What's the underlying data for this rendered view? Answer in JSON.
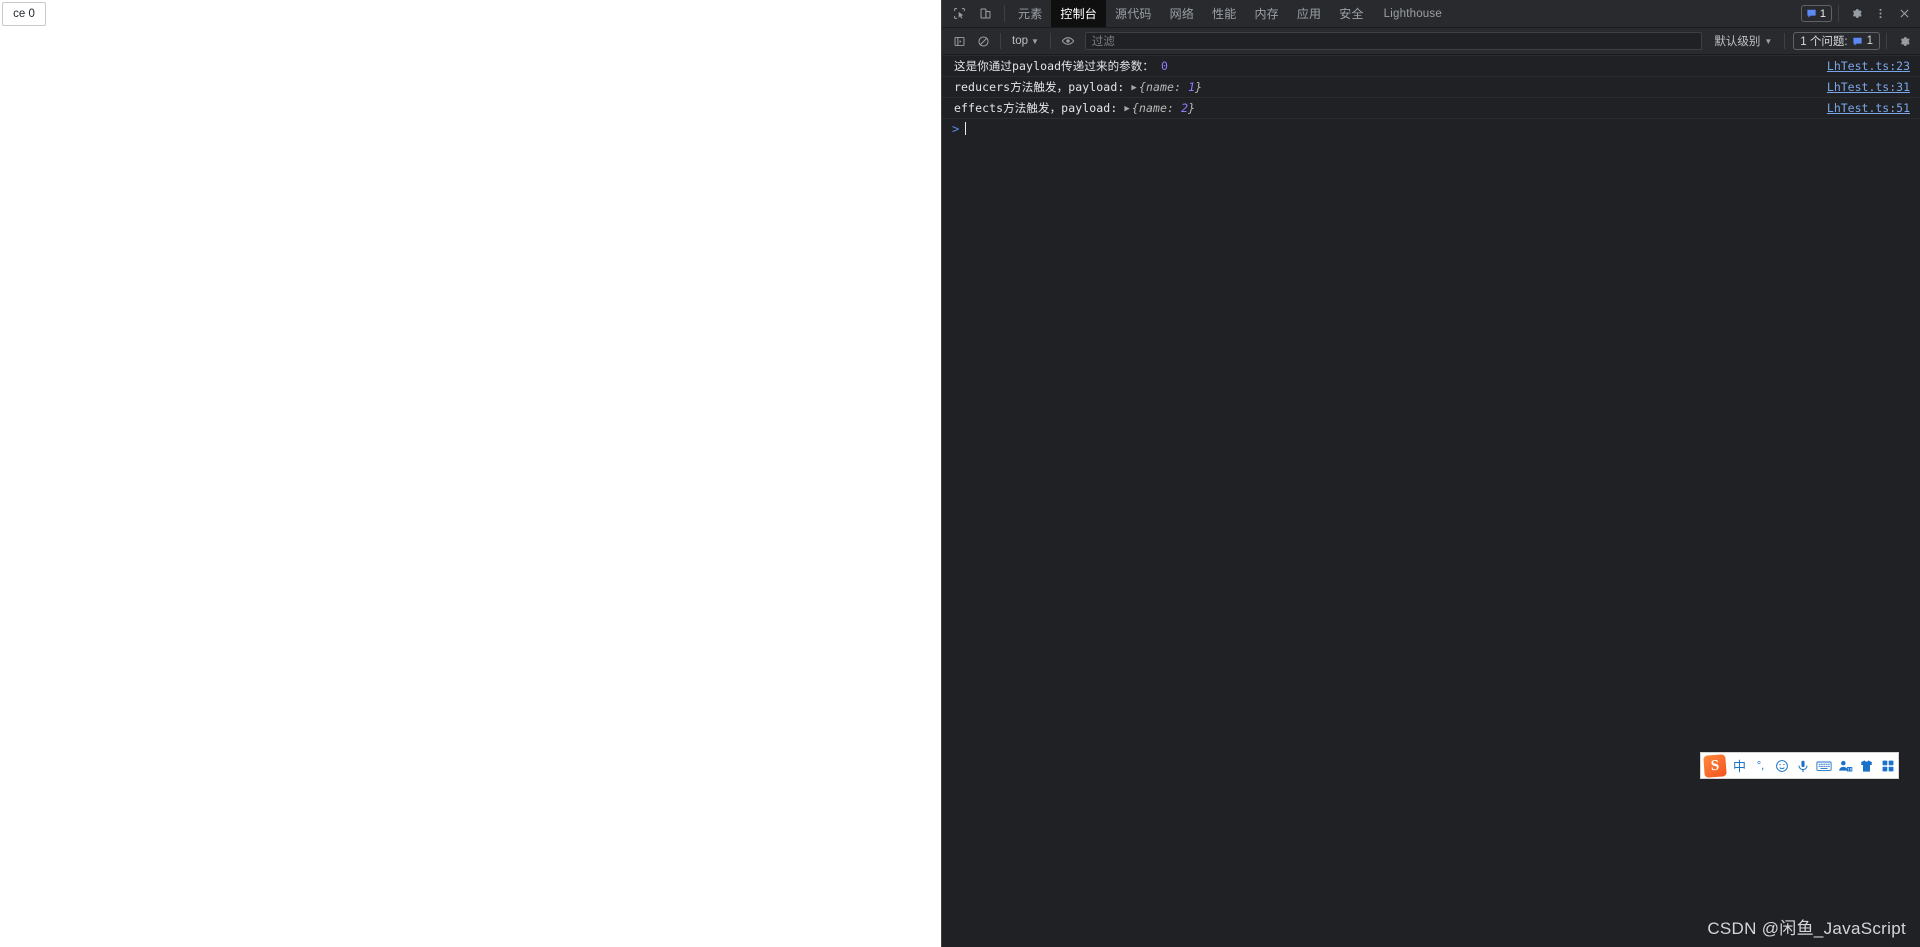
{
  "page": {
    "button_label": "ce 0"
  },
  "devtools": {
    "tabs": [
      {
        "label": "元素",
        "selected": false
      },
      {
        "label": "控制台",
        "selected": true
      },
      {
        "label": "源代码",
        "selected": false
      },
      {
        "label": "网络",
        "selected": false
      },
      {
        "label": "性能",
        "selected": false
      },
      {
        "label": "内存",
        "selected": false
      },
      {
        "label": "应用",
        "selected": false
      },
      {
        "label": "安全",
        "selected": false
      },
      {
        "label": "Lighthouse",
        "selected": false
      }
    ],
    "icons": {
      "inspect": "inspect-element-icon",
      "device": "device-toolbar-icon",
      "settings": "gear-icon",
      "more": "kebab-menu-icon",
      "close": "close-icon"
    },
    "issues_badge_count": "1",
    "toolbar": {
      "sidebar_toggle": "console-sidebar-icon",
      "clear_console": "clear-console-icon",
      "context": "top",
      "context_caret": "▼",
      "eye": "live-expression-icon",
      "filter_placeholder": "过滤",
      "filter_value": "",
      "level": "默认级别",
      "level_caret": "▼",
      "issues_label": "1 个问题:",
      "issues_count": "1",
      "settings": "gear-icon"
    },
    "messages": [
      {
        "prefix": "这是你通过payload传递过来的参数：",
        "value": "0",
        "has_object": false,
        "source": "LhTest.ts:23"
      },
      {
        "prefix": "reducers方法触发，payload:",
        "value": "1",
        "has_object": true,
        "object_open": "{name:",
        "object_close": "}",
        "source": "LhTest.ts:31"
      },
      {
        "prefix": "effects方法触发，payload:",
        "value": "2",
        "has_object": true,
        "object_open": "{name:",
        "object_close": "}",
        "source": "LhTest.ts:51"
      }
    ],
    "prompt": {
      "arrow": ">",
      "value": ""
    }
  },
  "ime": {
    "logo": "sogou-logo-icon",
    "items": [
      {
        "name": "language-mode",
        "glyph": "中"
      },
      {
        "name": "punctuation-mode",
        "glyph": "°,"
      },
      {
        "name": "emoji-icon",
        "glyph": "☺"
      },
      {
        "name": "voice-input-icon",
        "glyph": "mic"
      },
      {
        "name": "soft-keyboard-icon",
        "glyph": "keyboard"
      },
      {
        "name": "user-account-icon",
        "glyph": "user"
      },
      {
        "name": "skin-icon",
        "glyph": "shirt"
      },
      {
        "name": "toolbox-icon",
        "glyph": "grid"
      }
    ]
  },
  "watermark": {
    "text": "CSDN @闲鱼_JavaScript"
  },
  "colors": {
    "panel_bg": "#202124",
    "toolbar_bg": "#292a2d",
    "selected_tab_bg": "#0f0f0f",
    "accent_blue": "#5b8af5",
    "link_blue": "#7aa6e8",
    "number_purple": "#8d7cff"
  }
}
